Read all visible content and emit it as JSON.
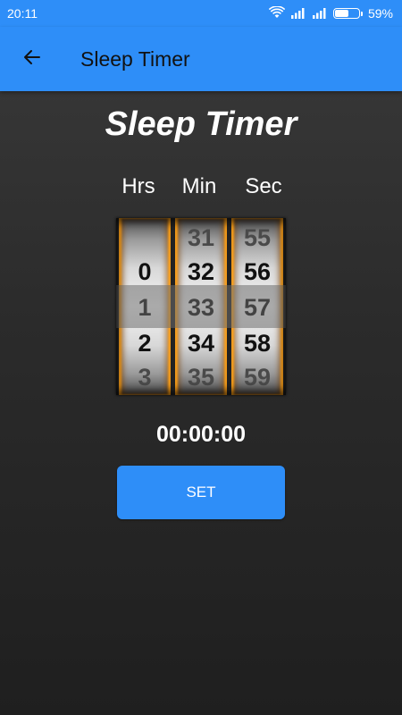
{
  "status_bar": {
    "time": "20:11",
    "battery_percent": "59%",
    "battery_level": 0.59
  },
  "app_bar": {
    "title": "Sleep Timer",
    "back_icon": "arrow-left-icon"
  },
  "screen_title": "Sleep Timer",
  "columns": {
    "hours": "Hrs",
    "minutes": "Min",
    "seconds": "Sec"
  },
  "wheels": {
    "hours": [
      "",
      "0",
      "1",
      "2",
      "3"
    ],
    "minutes": [
      "31",
      "32",
      "33",
      "34",
      "35"
    ],
    "seconds": [
      "55",
      "56",
      "57",
      "58",
      "59"
    ]
  },
  "selected": {
    "hours": "1",
    "minutes": "33",
    "seconds": "57"
  },
  "time_display": "00:00:00",
  "set_button": {
    "label": "SET"
  },
  "colors": {
    "accent": "#2e8ef8",
    "wheel_edge": "#ffa014",
    "background": "#2b2b2b"
  }
}
